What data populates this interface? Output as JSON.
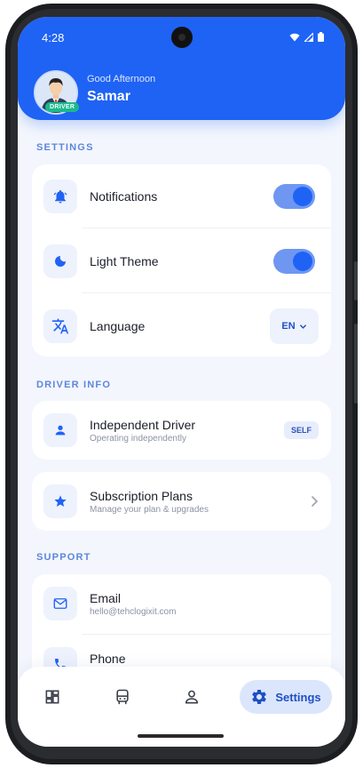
{
  "status_bar": {
    "time": "4:28"
  },
  "header": {
    "greeting": "Good Afternoon",
    "name": "Samar",
    "badge": "DRIVER"
  },
  "sections": {
    "settings": "SETTINGS",
    "driver_info": "DRIVER INFO",
    "support": "SUPPORT"
  },
  "settings": {
    "notifications": {
      "label": "Notifications",
      "icon": "bell-icon",
      "enabled": true
    },
    "light_theme": {
      "label": "Light Theme",
      "icon": "moon-icon",
      "enabled": true
    },
    "language": {
      "label": "Language",
      "icon": "translate-icon",
      "value": "EN"
    }
  },
  "driver_info": {
    "driver": {
      "title": "Independent Driver",
      "subtitle": "Operating independently",
      "badge": "SELF",
      "icon": "person-icon"
    },
    "subscription": {
      "title": "Subscription Plans",
      "subtitle": "Manage your plan & upgrades",
      "icon": "star-icon"
    }
  },
  "support": {
    "email": {
      "title": "Email",
      "subtitle": "hello@tehclogixit.com",
      "icon": "mail-icon"
    },
    "phone": {
      "title": "Phone",
      "icon": "phone-icon"
    }
  },
  "nav": {
    "items": [
      "dashboard-icon",
      "bus-icon",
      "profile-icon"
    ],
    "active_label": "Settings",
    "active_icon": "gear-icon"
  },
  "colors": {
    "primary": "#1f63f5",
    "background": "#f3f6fd",
    "badge_green": "#19b98b"
  }
}
